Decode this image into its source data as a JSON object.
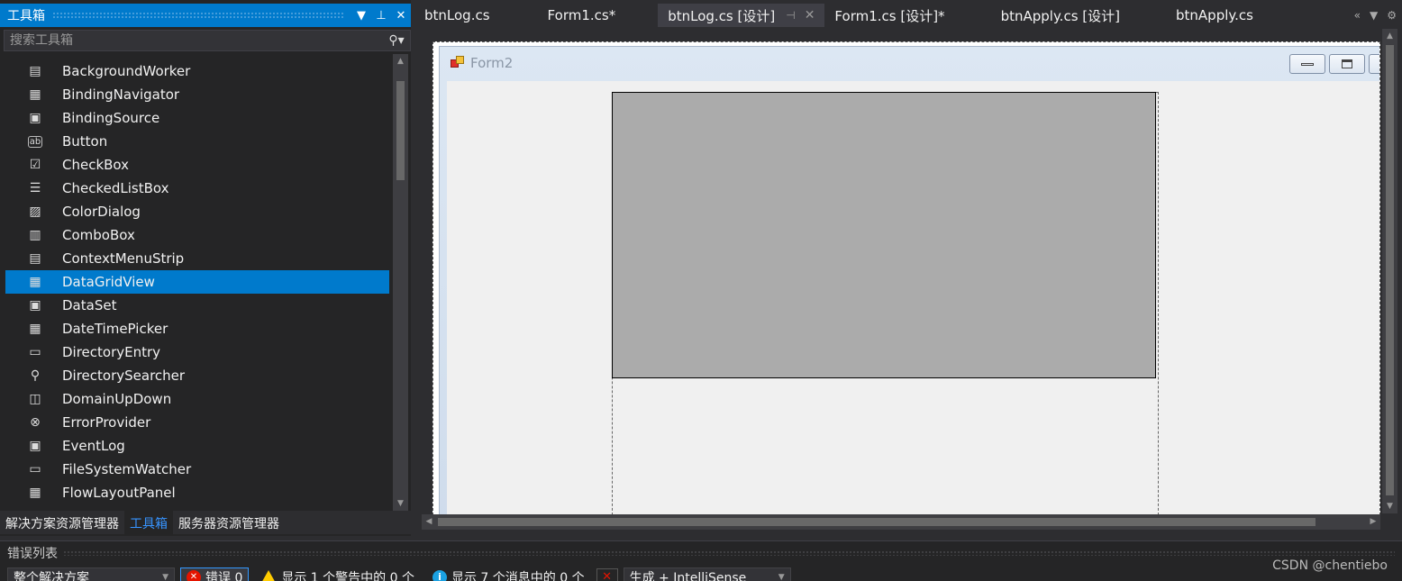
{
  "toolbox": {
    "title": "工具箱",
    "search_placeholder": "搜索工具箱",
    "items": [
      {
        "label": "BackgroundWorker",
        "icon": "background-worker-icon"
      },
      {
        "label": "BindingNavigator",
        "icon": "binding-navigator-icon"
      },
      {
        "label": "BindingSource",
        "icon": "binding-source-icon"
      },
      {
        "label": "Button",
        "icon": "button-icon"
      },
      {
        "label": "CheckBox",
        "icon": "checkbox-icon"
      },
      {
        "label": "CheckedListBox",
        "icon": "checked-list-box-icon"
      },
      {
        "label": "ColorDialog",
        "icon": "color-dialog-icon"
      },
      {
        "label": "ComboBox",
        "icon": "combo-box-icon"
      },
      {
        "label": "ContextMenuStrip",
        "icon": "context-menu-strip-icon"
      },
      {
        "label": "DataGridView",
        "icon": "data-grid-view-icon",
        "selected": true
      },
      {
        "label": "DataSet",
        "icon": "data-set-icon"
      },
      {
        "label": "DateTimePicker",
        "icon": "date-time-picker-icon"
      },
      {
        "label": "DirectoryEntry",
        "icon": "directory-entry-icon"
      },
      {
        "label": "DirectorySearcher",
        "icon": "directory-searcher-icon"
      },
      {
        "label": "DomainUpDown",
        "icon": "domain-up-down-icon"
      },
      {
        "label": "ErrorProvider",
        "icon": "error-provider-icon"
      },
      {
        "label": "EventLog",
        "icon": "event-log-icon"
      },
      {
        "label": "FileSystemWatcher",
        "icon": "file-system-watcher-icon"
      },
      {
        "label": "FlowLayoutPanel",
        "icon": "flow-layout-panel-icon"
      }
    ],
    "bottom_tabs": [
      "解决方案资源管理器",
      "工具箱",
      "服务器资源管理器"
    ],
    "active_bottom_tab": 1
  },
  "doc_tabs": [
    {
      "label": "btnLog.cs"
    },
    {
      "label": "Form1.cs*"
    },
    {
      "label": "btnLog.cs [设计]",
      "active": true
    },
    {
      "label": "Form1.cs [设计]*"
    },
    {
      "label": "btnApply.cs [设计]"
    },
    {
      "label": "btnApply.cs"
    }
  ],
  "designer": {
    "form_title": "Form2"
  },
  "error_list": {
    "title": "错误列表",
    "scope": "整个解决方案",
    "errors_label": "错误 0",
    "warnings_label": "显示 1 个警告中的 0 个",
    "messages_label": "显示 7 个消息中的 0 个",
    "build_filter": "生成 + IntelliSense"
  },
  "watermark": "CSDN @chentiebo",
  "colors": {
    "accent": "#007acc",
    "selection": "#007acc",
    "panel_gray": "#ababab",
    "error_red": "#e51400",
    "warning_yellow": "#ffcc00",
    "info_blue": "#1ba1e2"
  }
}
